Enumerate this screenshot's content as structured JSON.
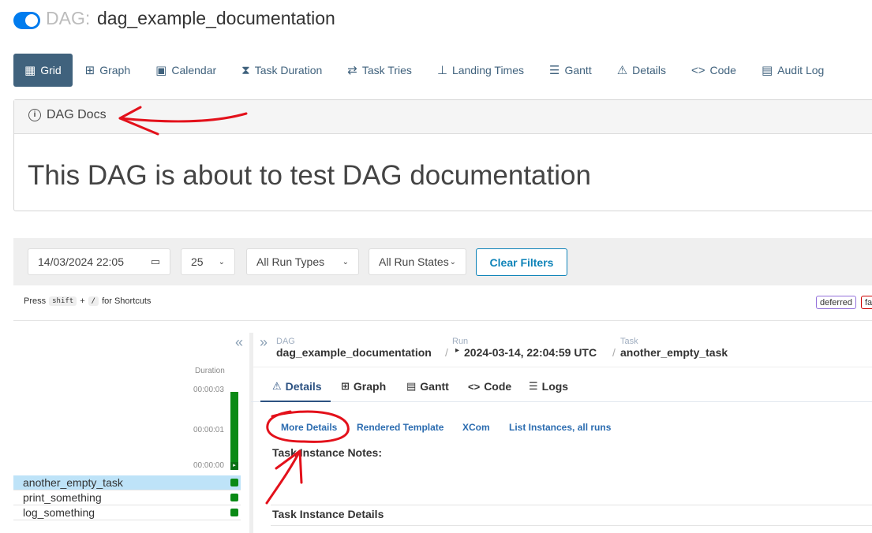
{
  "header": {
    "prefix": "DAG:",
    "dag_id": "dag_example_documentation"
  },
  "nav": [
    {
      "label": "Grid",
      "icon": "grid-icon"
    },
    {
      "label": "Graph",
      "icon": "graph-icon"
    },
    {
      "label": "Calendar",
      "icon": "calendar-icon"
    },
    {
      "label": "Task Duration",
      "icon": "hourglass-icon"
    },
    {
      "label": "Task Tries",
      "icon": "repeat-icon"
    },
    {
      "label": "Landing Times",
      "icon": "plane-icon"
    },
    {
      "label": "Gantt",
      "icon": "gantt-icon"
    },
    {
      "label": "Details",
      "icon": "warning-icon"
    },
    {
      "label": "Code",
      "icon": "code-icon"
    },
    {
      "label": "Audit Log",
      "icon": "file-search-icon"
    }
  ],
  "docs": {
    "title": "DAG Docs",
    "body": "This DAG is about to test DAG documentation"
  },
  "filters": {
    "date": "14/03/2024 22:05",
    "count": "25",
    "run_types": "All Run Types",
    "run_states": "All Run States",
    "clear": "Clear Filters"
  },
  "shortcuts": {
    "press": "Press",
    "key1": "shift",
    "plus": "+",
    "key2": "/",
    "suffix": "for Shortcuts"
  },
  "legend": [
    {
      "label": "deferred",
      "color": "#9370db"
    },
    {
      "label": "fa",
      "color": "#cc0000"
    }
  ],
  "grid": {
    "duration_label": "Duration",
    "ticks": [
      "00:00:03",
      "00:00:01",
      "00:00:00"
    ],
    "tasks": [
      {
        "name": "another_empty_task",
        "state": "success"
      },
      {
        "name": "print_something",
        "state": "success"
      },
      {
        "name": "log_something",
        "state": "success"
      }
    ]
  },
  "breadcrumb": {
    "dag_label": "DAG",
    "dag_value": "dag_example_documentation",
    "run_label": "Run",
    "run_value": "2024-03-14, 22:04:59 UTC",
    "task_label": "Task",
    "task_value": "another_empty_task"
  },
  "tabs": [
    {
      "label": "Details",
      "icon": "warning-icon"
    },
    {
      "label": "Graph",
      "icon": "graph-icon"
    },
    {
      "label": "Gantt",
      "icon": "gantt-icon"
    },
    {
      "label": "Code",
      "icon": "code-icon"
    },
    {
      "label": "Logs",
      "icon": "list-icon"
    }
  ],
  "sublinks": [
    "More Details",
    "Rendered Template",
    "XCom",
    "List Instances, all runs"
  ],
  "sections": {
    "notes": "Task Instance Notes:",
    "details": "Task Instance Details"
  },
  "colors": {
    "primary": "#40627d",
    "success": "#0a8a15",
    "accent": "#017cee",
    "annotation": "#e3111b"
  }
}
